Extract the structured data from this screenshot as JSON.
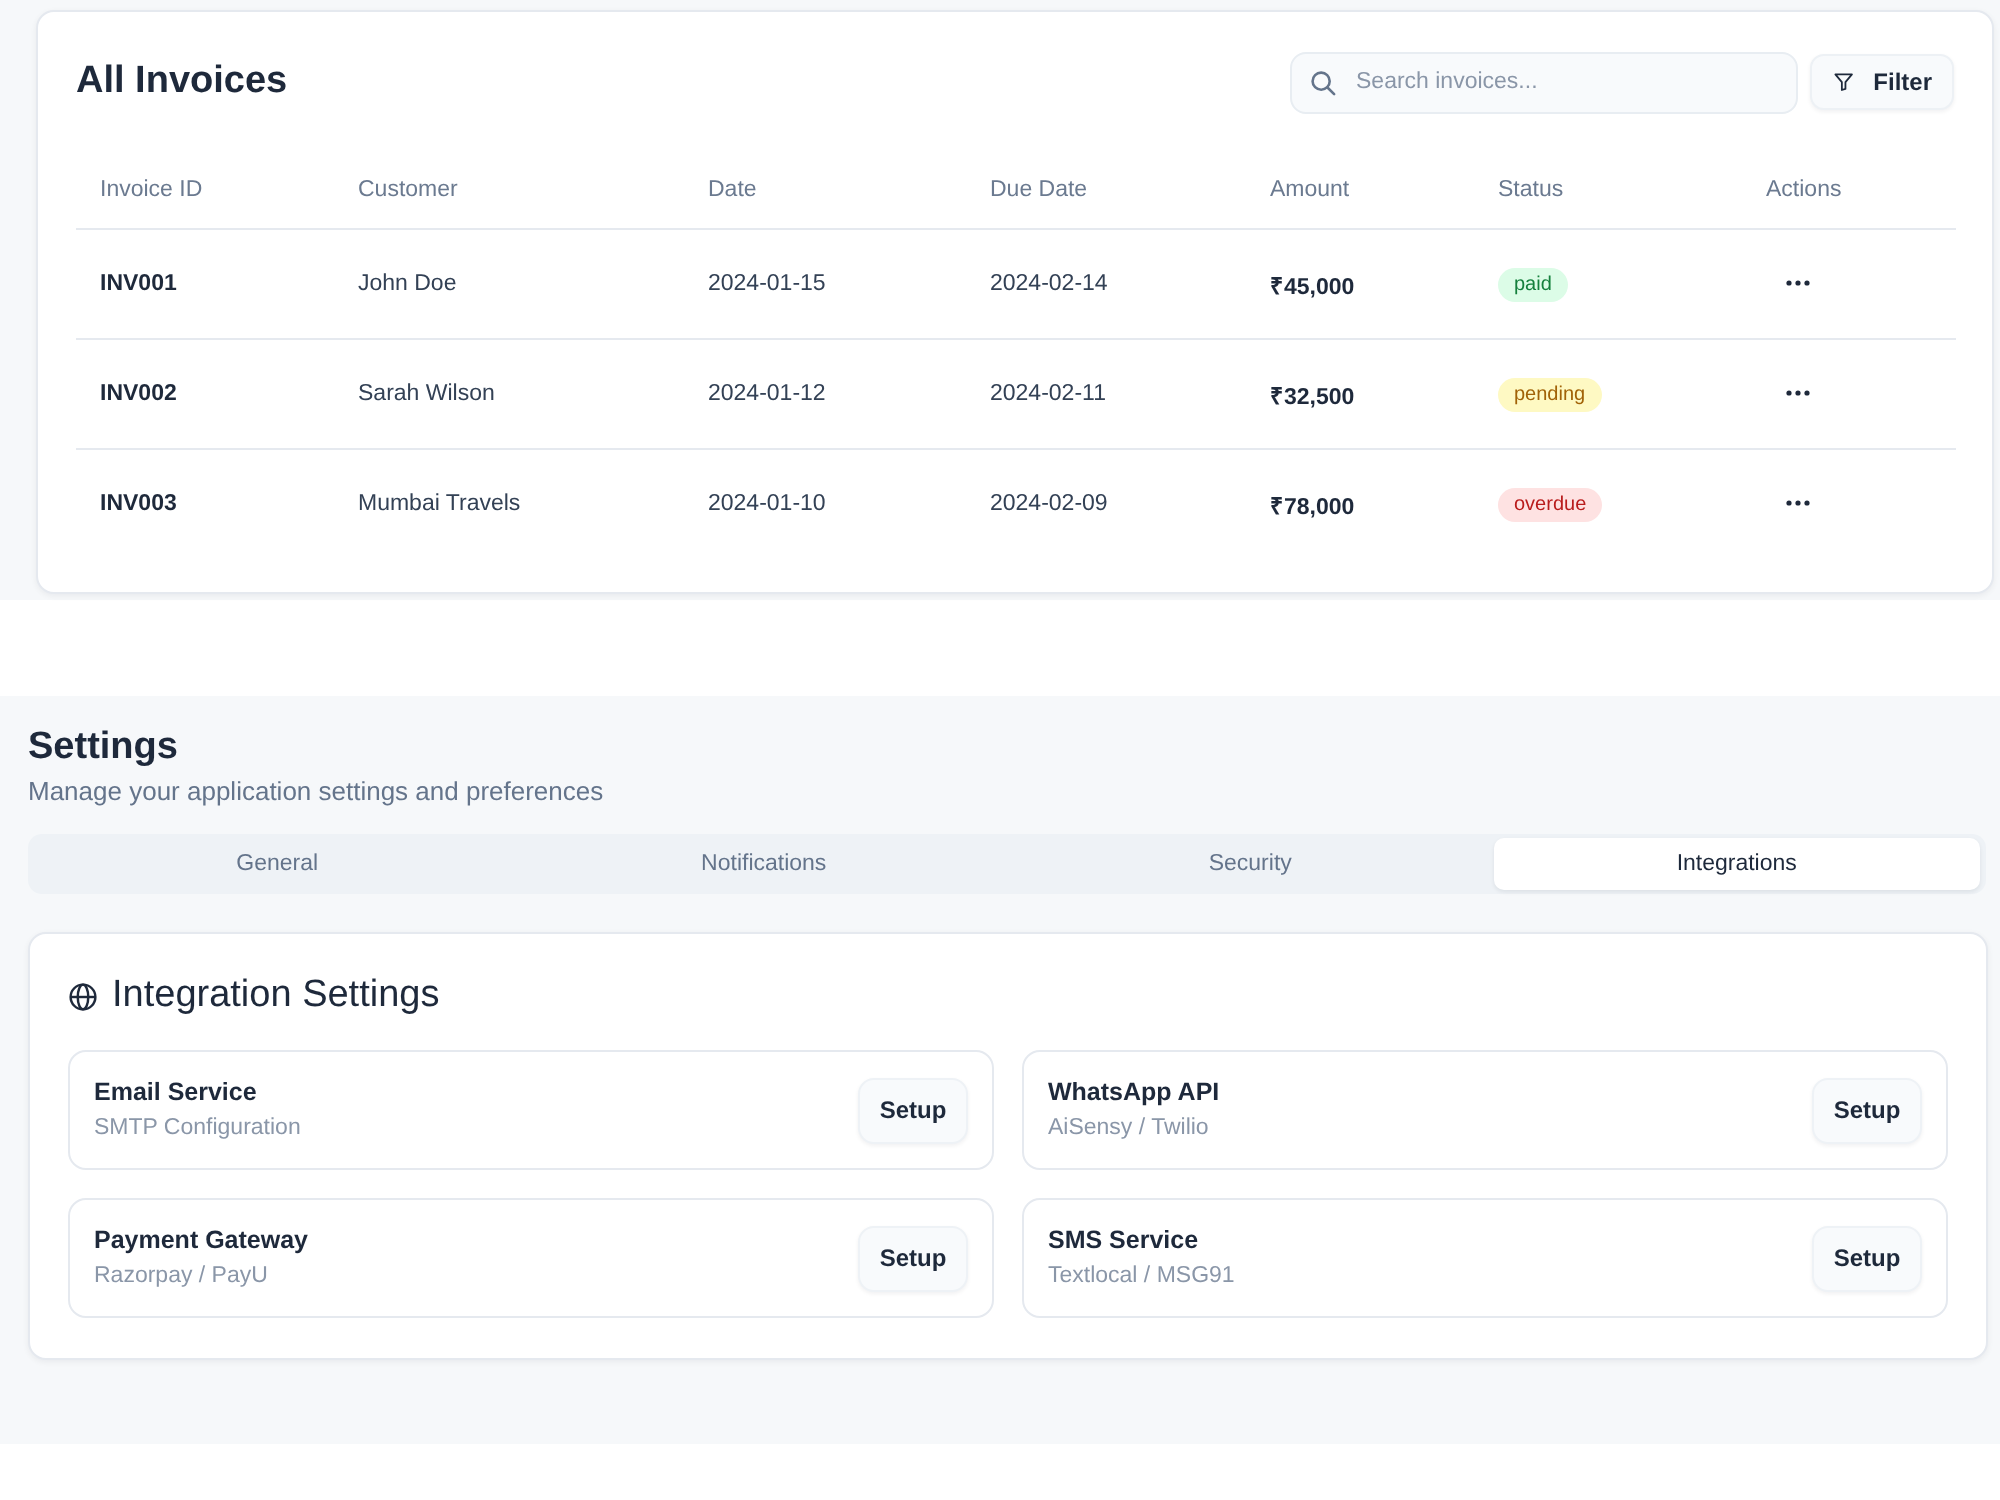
{
  "invoices": {
    "title": "All Invoices",
    "search": {
      "placeholder": "Search invoices..."
    },
    "filter_button": "Filter",
    "table": {
      "columns": [
        "Invoice ID",
        "Customer",
        "Date",
        "Due Date",
        "Amount",
        "Status",
        "Actions"
      ],
      "rows": [
        {
          "id": "INV001",
          "customer": "John Doe",
          "date": "2024-01-15",
          "due_date": "2024-02-14",
          "amount": "₹45,000",
          "status": {
            "text": "paid",
            "kind": "success"
          }
        },
        {
          "id": "INV002",
          "customer": "Sarah Wilson",
          "date": "2024-01-12",
          "due_date": "2024-02-11",
          "amount": "₹32,500",
          "status": {
            "text": "pending",
            "kind": "warning"
          }
        },
        {
          "id": "INV003",
          "customer": "Mumbai Travels",
          "date": "2024-01-10",
          "due_date": "2024-02-09",
          "amount": "₹78,000",
          "status": {
            "text": "overdue",
            "kind": "danger"
          }
        }
      ]
    }
  },
  "settings": {
    "title": "Settings",
    "subtitle": "Manage your application settings and preferences",
    "tabs": [
      {
        "label": "General",
        "selected": false
      },
      {
        "label": "Notifications",
        "selected": false
      },
      {
        "label": "Security",
        "selected": false
      },
      {
        "label": "Integrations",
        "selected": true
      }
    ],
    "panel": {
      "title": "Integration Settings",
      "integrations": [
        {
          "name": "Email Service",
          "detail": "SMTP Configuration",
          "button": "Setup"
        },
        {
          "name": "WhatsApp API",
          "detail": "AiSensy / Twilio",
          "button": "Setup"
        },
        {
          "name": "Payment Gateway",
          "detail": "Razorpay / PayU",
          "button": "Setup"
        },
        {
          "name": "SMS Service",
          "detail": "Textlocal / MSG91",
          "button": "Setup"
        }
      ]
    }
  }
}
